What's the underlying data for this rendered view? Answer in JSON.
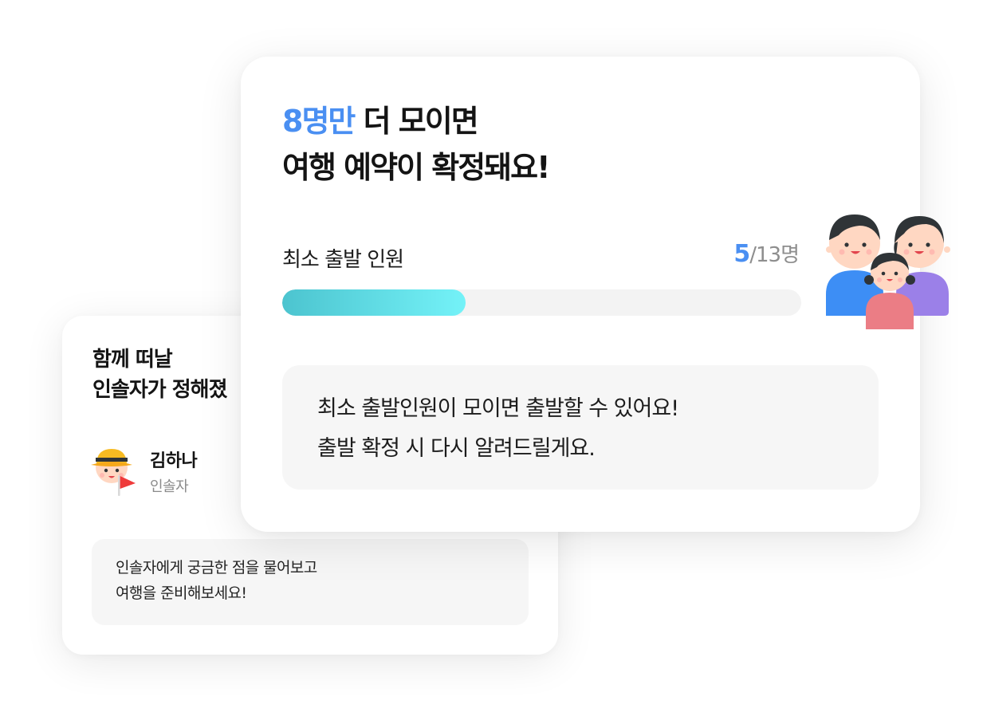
{
  "guide_card": {
    "title_line1": "함께 떠날",
    "title_line2": "인솔자가 정해졌",
    "guide_name": "김하나",
    "guide_role": "인솔자",
    "message_line1": "인솔자에게 궁금한 점을 물어보고",
    "message_line2": "여행을 준비해보세요!",
    "icons": [
      "guide-avatar-icon",
      "flag-icon"
    ]
  },
  "status_card": {
    "title_highlight": "8명만",
    "title_rest_line1": " 더 모이면",
    "title_line2": "여행 예약이 확정돼요!",
    "min_label": "최소 출발 인원",
    "count_current": "5",
    "count_total": "/13명",
    "progress_fraction": 0.353,
    "message_line1": "최소 출발인원이 모이면 출발할 수 있어요!",
    "message_line2": "출발 확정 시 다시 알려드릴게요.",
    "icons": [
      "family-icon"
    ]
  },
  "colors": {
    "accent": "#4a8ff2",
    "progress_start": "#4cc4cf",
    "progress_end": "#74f2f8",
    "progress_track": "#f3f3f3",
    "message_bg": "#f6f6f6",
    "muted_text": "#8e8e8e"
  }
}
